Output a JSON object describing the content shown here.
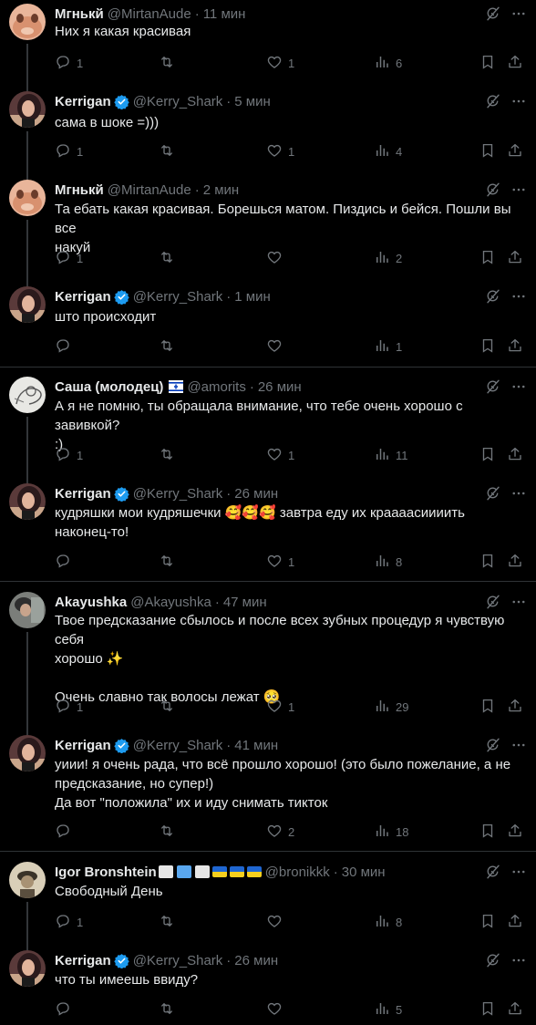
{
  "posts": [
    {
      "name": "Мгнькй",
      "handle": "@MirtanAude",
      "time": "11 мин",
      "text": "Них я какая красивая",
      "replies": "1",
      "reposts": "",
      "likes": "1",
      "views": "6"
    },
    {
      "name": "Kerrigan",
      "handle": "@Kerry_Shark",
      "time": "5 мин",
      "text": "сама в шоке =)))",
      "replies": "1",
      "reposts": "",
      "likes": "1",
      "views": "4"
    },
    {
      "name": "Мгнькй",
      "handle": "@MirtanAude",
      "time": "2 мин",
      "text": "Та ебать какая красивая. Борешься матом. Пиздись и бейся. Пошли вы все\nнакуй",
      "replies": "1",
      "reposts": "",
      "likes": "",
      "views": "2"
    },
    {
      "name": "Kerrigan",
      "handle": "@Kerry_Shark",
      "time": "1 мин",
      "text": "што происходит",
      "replies": "",
      "reposts": "",
      "likes": "",
      "views": "1"
    },
    {
      "name": "Саша (молодец)",
      "handle": "@amorits",
      "time": "26 мин",
      "text": "А я не помню, ты обращала внимание, что тебе очень хорошо с завивкой?\n:)",
      "replies": "1",
      "reposts": "",
      "likes": "1",
      "views": "11"
    },
    {
      "name": "Kerrigan",
      "handle": "@Kerry_Shark",
      "time": "26 мин",
      "text": "кудряшки мои кудряшечки 🥰🥰🥰 завтра еду их краааасиииить\nнаконец-то!",
      "replies": "",
      "reposts": "",
      "likes": "1",
      "views": "8"
    },
    {
      "name": "Akayushka",
      "handle": "@Akayushka",
      "time": "47 мин",
      "text": "Твое предсказание сбылось и после всех зубных процедур я чувствую себя\nхорошо ✨\n\nОчень славно так волосы лежат 🥺",
      "replies": "1",
      "reposts": "",
      "likes": "1",
      "views": "29"
    },
    {
      "name": "Kerrigan",
      "handle": "@Kerry_Shark",
      "time": "41 мин",
      "text": "уиии! я очень рада, что всё прошло хорошо! (это было пожелание, а не\nпредсказание, но супер!)\nДа вот \"положила\" их и иду снимать тикток",
      "replies": "",
      "reposts": "",
      "likes": "2",
      "views": "18"
    },
    {
      "name": "Igor Bronshtein",
      "handle": "@bronikkk",
      "time": "30 мин",
      "text": "Свободный День",
      "replies": "1",
      "reposts": "",
      "likes": "",
      "views": "8"
    },
    {
      "name": "Kerrigan",
      "handle": "@Kerry_Shark",
      "time": "26 мин",
      "text": "что ты имеешь ввиду?",
      "replies": "",
      "reposts": "",
      "likes": "",
      "views": "5"
    }
  ],
  "colors": {
    "background": "#000000",
    "text": "#e7e9ea",
    "muted": "#71767b",
    "verified": "#1d9bf0",
    "divider": "#2f3336"
  },
  "icons": [
    "reply-icon",
    "repost-icon",
    "like-icon",
    "views-icon",
    "bookmark-icon",
    "share-icon",
    "grok-icon",
    "more-icon",
    "verified-icon",
    "israel-flag-icon",
    "ukraine-flag-icon"
  ]
}
